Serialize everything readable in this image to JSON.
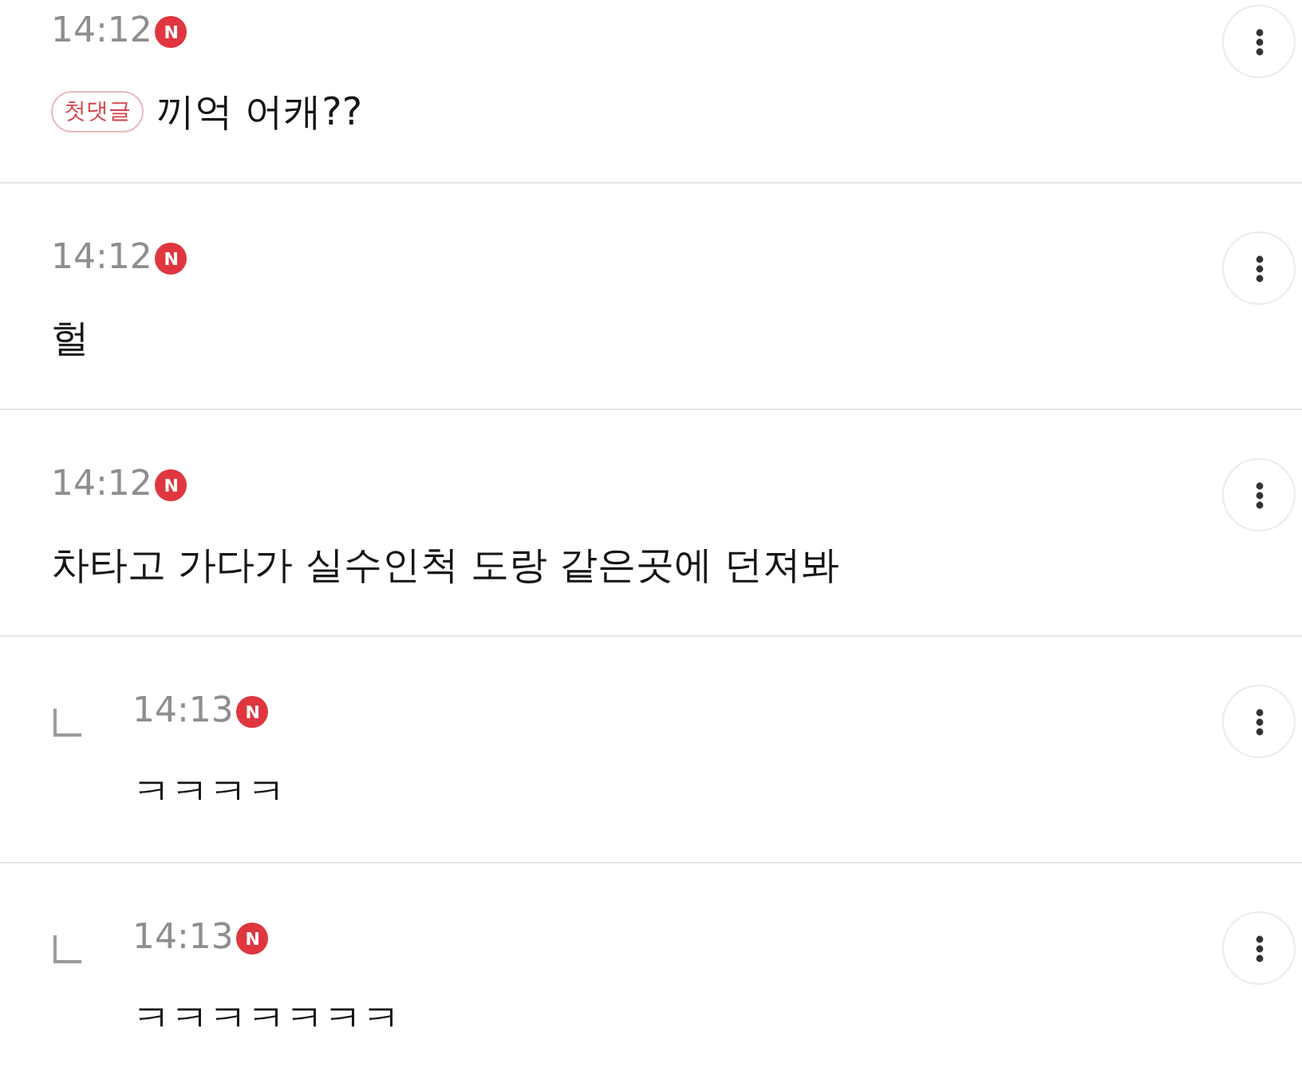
{
  "comments": [
    {
      "kind": "comment",
      "time": "14:12",
      "new_badge": "N",
      "tag": "첫댓글",
      "text": "끼억 어캐??"
    },
    {
      "kind": "comment",
      "time": "14:12",
      "new_badge": "N",
      "text": "헐"
    },
    {
      "kind": "comment",
      "time": "14:12",
      "new_badge": "N",
      "text": "차타고 가다가 실수인척 도랑 같은곳에 던져봐"
    },
    {
      "kind": "reply",
      "time": "14:13",
      "new_badge": "N",
      "text": "ㅋㅋㅋㅋ"
    },
    {
      "kind": "reply",
      "time": "14:13",
      "new_badge": "N",
      "text": "ㅋㅋㅋㅋㅋㅋㅋ"
    }
  ]
}
